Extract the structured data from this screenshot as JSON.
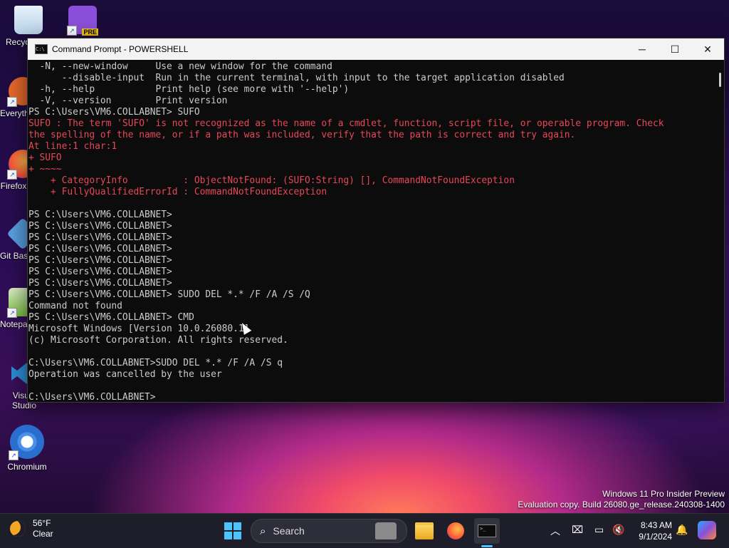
{
  "desktop_icons": [
    {
      "name": "recycle-bin",
      "label": "Recycle Bin",
      "color": "#cfe3f5"
    },
    {
      "name": "visual-studio-preview",
      "label": "",
      "badge": "PRE",
      "color": "#8a4fd8"
    },
    {
      "name": "everything",
      "label": "Everything",
      "color": "#e76a2c"
    },
    {
      "name": "firefox",
      "label": "Firefox",
      "color": "#ff7139"
    },
    {
      "name": "git-bash",
      "label": "Git Bash",
      "color": "#5aa0e0"
    },
    {
      "name": "notepad-plus-plus",
      "label": "Notepad++",
      "color": "#7ac142"
    },
    {
      "name": "visual-studio-code",
      "label": "Visual Studio Code",
      "color": "#2f8ed6"
    },
    {
      "name": "chromium",
      "label": "Chromium",
      "color": "#4a8fe8"
    }
  ],
  "window": {
    "title": "Command Prompt - POWERSHELL",
    "minimize": "─",
    "maximize": "☐",
    "close": "✕",
    "cmd_icon_text": "C:\\",
    "lines": [
      {
        "text": "  -N, --new-window     Use a new window for the command",
        "err": false
      },
      {
        "text": "      --disable-input  Run in the current terminal, with input to the target application disabled",
        "err": false
      },
      {
        "text": "  -h, --help           Print help (see more with '--help')",
        "err": false
      },
      {
        "text": "  -V, --version        Print version",
        "err": false
      },
      {
        "text": "PS C:\\Users\\VM6.COLLABNET> SUFO",
        "err": false
      },
      {
        "text": "SUFO : The term 'SUFO' is not recognized as the name of a cmdlet, function, script file, or operable program. Check",
        "err": true
      },
      {
        "text": "the spelling of the name, or if a path was included, verify that the path is correct and try again.",
        "err": true
      },
      {
        "text": "At line:1 char:1",
        "err": true
      },
      {
        "text": "+ SUFO",
        "err": true
      },
      {
        "text": "+ ~~~~",
        "err": true
      },
      {
        "text": "    + CategoryInfo          : ObjectNotFound: (SUFO:String) [], CommandNotFoundException",
        "err": true
      },
      {
        "text": "    + FullyQualifiedErrorId : CommandNotFoundException",
        "err": true
      },
      {
        "text": "",
        "err": false
      },
      {
        "text": "PS C:\\Users\\VM6.COLLABNET>",
        "err": false
      },
      {
        "text": "PS C:\\Users\\VM6.COLLABNET>",
        "err": false
      },
      {
        "text": "PS C:\\Users\\VM6.COLLABNET>",
        "err": false
      },
      {
        "text": "PS C:\\Users\\VM6.COLLABNET>",
        "err": false
      },
      {
        "text": "PS C:\\Users\\VM6.COLLABNET>",
        "err": false
      },
      {
        "text": "PS C:\\Users\\VM6.COLLABNET>",
        "err": false
      },
      {
        "text": "PS C:\\Users\\VM6.COLLABNET>",
        "err": false
      },
      {
        "text": "PS C:\\Users\\VM6.COLLABNET> SUDO DEL *.* /F /A /S /Q",
        "err": false
      },
      {
        "text": "Command not found",
        "err": false
      },
      {
        "text": "PS C:\\Users\\VM6.COLLABNET> CMD",
        "err": false
      },
      {
        "text": "Microsoft Windows [Version 10.0.26080.1]",
        "err": false
      },
      {
        "text": "(c) Microsoft Corporation. All rights reserved.",
        "err": false
      },
      {
        "text": "",
        "err": false
      },
      {
        "text": "C:\\Users\\VM6.COLLABNET>SUDO DEL *.* /F /A /S q",
        "err": false
      },
      {
        "text": "Operation was cancelled by the user",
        "err": false
      },
      {
        "text": "",
        "err": false
      },
      {
        "text": "C:\\Users\\VM6.COLLABNET>",
        "err": false
      }
    ]
  },
  "watermark": {
    "line1": "Windows 11 Pro Insider Preview",
    "line2": "Evaluation copy. Build 26080.ge_release.240308-1400"
  },
  "taskbar": {
    "weather_temp": "56°F",
    "weather_desc": "Clear",
    "search_label": "Search",
    "time": "8:43 AM",
    "date": "9/1/2024",
    "icons": [
      "start-icon",
      "search-icon",
      "file-explorer-icon",
      "firefox-icon",
      "terminal-icon",
      "chevron-up-icon",
      "network-icon",
      "display-icon",
      "volume-icon",
      "notification-bell-icon",
      "copilot-icon"
    ]
  }
}
